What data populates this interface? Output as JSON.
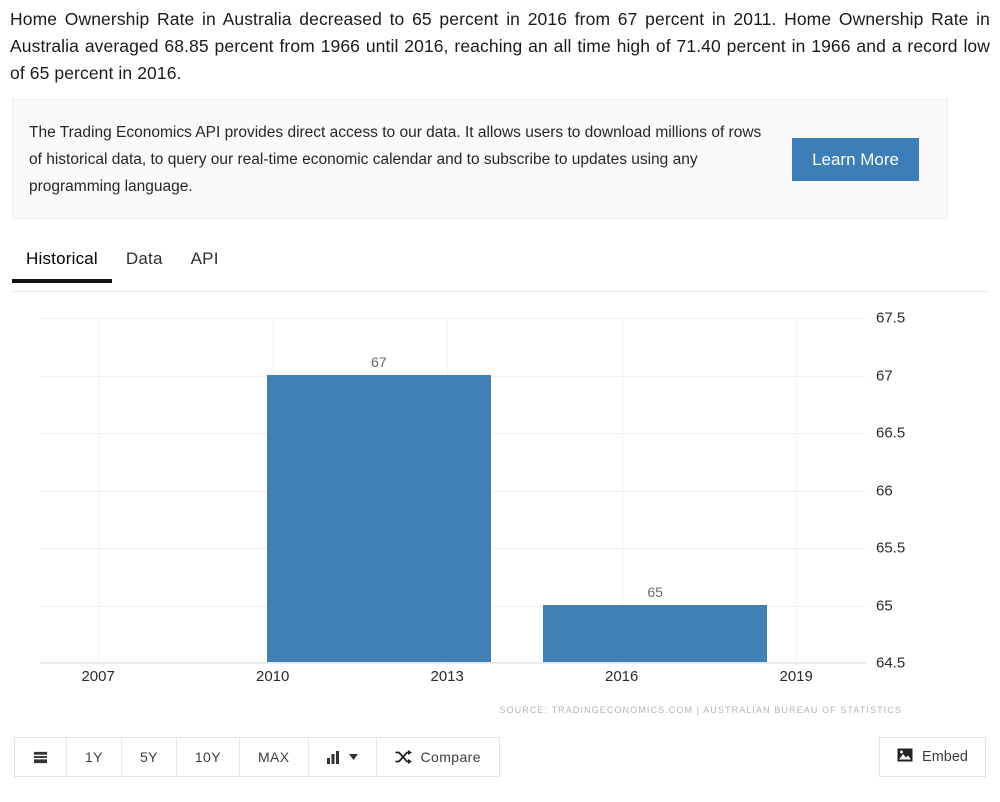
{
  "intro": {
    "text": "Home Ownership Rate in Australia decreased to 65 percent in 2016 from 67 percent in 2011. Home Ownership Rate in Australia averaged 68.85 percent from 1966 until 2016, reaching an all time high of 71.40 percent in 1966 and a record low of 65 percent in 2016."
  },
  "promo": {
    "text": "The Trading Economics API provides direct access to our data. It allows users to download millions of rows of historical data, to query our real-time economic calendar and to subscribe to updates using any programming language.",
    "button_label": "Learn More",
    "button_color": "#3c7eb8"
  },
  "tabs": [
    {
      "label": "Historical",
      "active": true
    },
    {
      "label": "Data",
      "active": false
    },
    {
      "label": "API",
      "active": false
    }
  ],
  "chart_data": {
    "type": "bar",
    "title": "",
    "xlabel": "",
    "ylabel": "",
    "categories": [
      "2011",
      "2016"
    ],
    "values": [
      67,
      65
    ],
    "data_labels": [
      "67",
      "65"
    ],
    "bar_color": "#4180b4",
    "ylim": [
      64.5,
      67.5
    ],
    "yticks": [
      "67.5",
      "67",
      "66.5",
      "66",
      "65.5",
      "65",
      "64.5"
    ],
    "ytick_values": [
      67.5,
      67,
      66.5,
      66,
      65.5,
      65,
      64.5
    ],
    "xticks": [
      "2007",
      "2010",
      "2013",
      "2016",
      "2019"
    ],
    "xtick_values": [
      2007,
      2010,
      2013,
      2016,
      2019
    ],
    "grid": true,
    "legend": "none",
    "y_axis_position": "right",
    "source": "SOURCE: TRADINGECONOMICS.COM  |  AUSTRALIAN BUREAU OF STATISTICS"
  },
  "toolbar": {
    "range_buttons": [
      "1Y",
      "5Y",
      "10Y",
      "MAX"
    ],
    "compare_label": "Compare",
    "embed_label": "Embed"
  }
}
